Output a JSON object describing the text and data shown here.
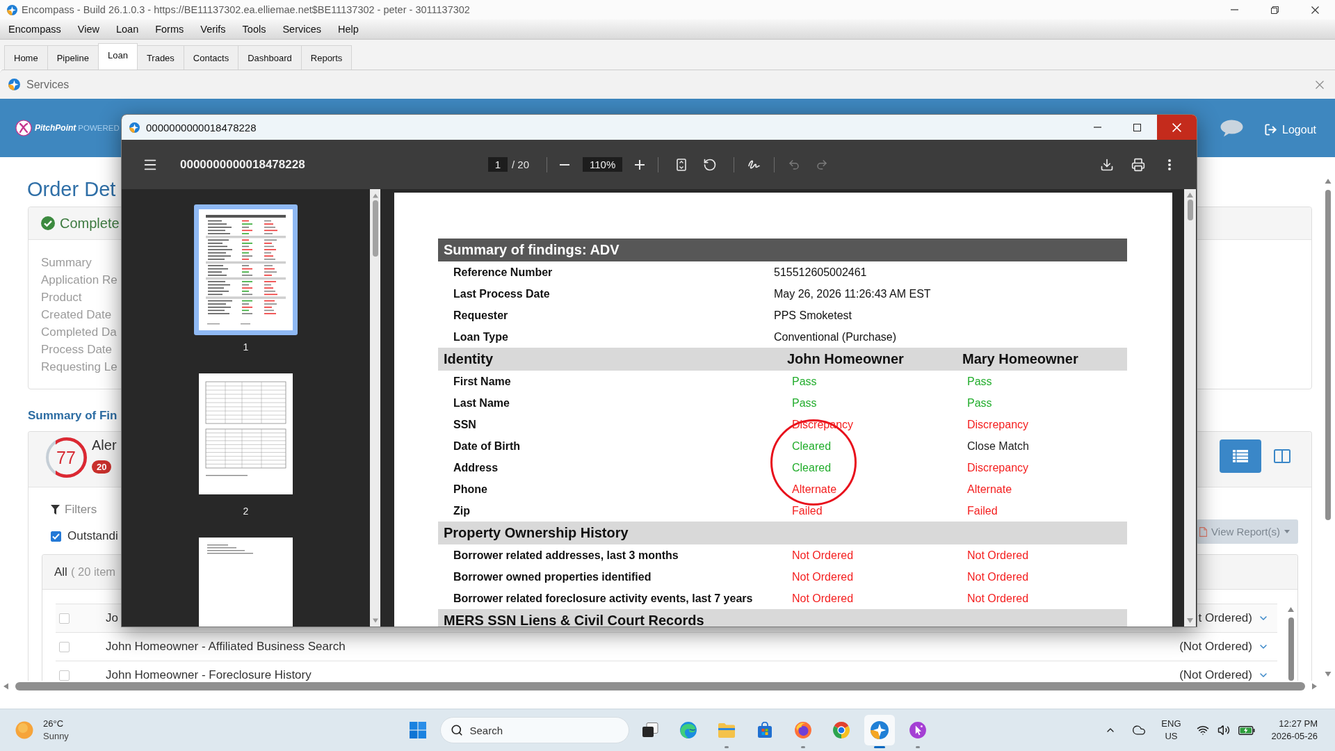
{
  "window": {
    "title": "Encompass - Build 26.1.0.3 - https://BE11137302.ea.elliemae.net$BE11137302 - peter - 3011137302"
  },
  "menu": [
    "Encompass",
    "View",
    "Loan",
    "Forms",
    "Verifs",
    "Tools",
    "Services",
    "Help"
  ],
  "tabs": [
    {
      "label": "Home",
      "selected": false
    },
    {
      "label": "Pipeline",
      "selected": false
    },
    {
      "label": "Loan",
      "selected": true
    },
    {
      "label": "Trades",
      "selected": false
    },
    {
      "label": "Contacts",
      "selected": false
    },
    {
      "label": "Dashboard",
      "selected": false
    },
    {
      "label": "Reports",
      "selected": false
    }
  ],
  "services_panel": {
    "title": "Services"
  },
  "header": {
    "brand": "PitchPoint",
    "tagline": "POWERED",
    "logout": "Logout"
  },
  "order_details": {
    "title": "Order Det",
    "status": "Complete",
    "fields": [
      "Summary",
      "Application Re",
      "Product",
      "Created Date",
      "Completed Da",
      "Process Date",
      "Requesting Le"
    ]
  },
  "findings": {
    "heading": "Summary of Fin",
    "score": "77",
    "level": 0.77,
    "alerts_label": "Aler",
    "alerts_count": "20",
    "views": [
      {
        "kind": "list",
        "selected": true
      },
      {
        "kind": "split",
        "selected": false
      }
    ],
    "filters_label": "Filters",
    "outstanding": {
      "label": "Outstandi",
      "checked": true
    },
    "view_reports": {
      "label": "View Report(s)",
      "disabled": true
    },
    "list": {
      "title": "All",
      "count": "( 20 item",
      "rows": [
        {
          "name": "Jo",
          "status": "t Ordered)",
          "checked": false
        },
        {
          "name": "John Homeowner - Affiliated Business Search",
          "status": "(Not Ordered)",
          "checked": false
        },
        {
          "name": "John Homeowner - Foreclosure History",
          "status": "(Not Ordered)",
          "checked": false
        }
      ]
    }
  },
  "viewer": {
    "window_title": "0000000000018478228",
    "doc_title": "0000000000018478228",
    "page": "1",
    "page_total": "/ 20",
    "zoom": "110%",
    "undo_disabled": true,
    "redo_disabled": true,
    "thumbnails": [
      {
        "label": "1",
        "selected": true
      },
      {
        "label": "2",
        "selected": false
      },
      {
        "selected": false
      }
    ],
    "report": {
      "title": "Summary of findings: ADV",
      "info": [
        {
          "label": "Reference Number",
          "value": "515512605002461"
        },
        {
          "label": "Last Process Date",
          "value": "May 26, 2026 11:26:43 AM EST"
        },
        {
          "label": "Requester",
          "value": "PPS Smoketest"
        },
        {
          "label": "Loan Type",
          "value": "Conventional (Purchase)"
        }
      ],
      "sections": [
        {
          "title": "Identity",
          "columns": [
            "John Homeowner",
            "Mary Homeowner"
          ],
          "rows": [
            {
              "label": "First Name",
              "results": [
                {
                  "text": "Pass",
                  "color": "#22ad2c"
                },
                {
                  "text": "Pass",
                  "color": "#22ad2c"
                }
              ]
            },
            {
              "label": "Last Name",
              "results": [
                {
                  "text": "Pass",
                  "color": "#22ad2c"
                },
                {
                  "text": "Pass",
                  "color": "#22ad2c"
                }
              ]
            },
            {
              "label": "SSN",
              "results": [
                {
                  "text": "Discrepancy",
                  "color": "#f41e1e"
                },
                {
                  "text": "Discrepancy",
                  "color": "#f41e1e"
                }
              ]
            },
            {
              "label": "Date of Birth",
              "results": [
                {
                  "text": "Cleared",
                  "color": "#22ad2c"
                },
                {
                  "text": "Close Match",
                  "color": "#222222"
                }
              ]
            },
            {
              "label": "Address",
              "results": [
                {
                  "text": "Cleared",
                  "color": "#22ad2c"
                },
                {
                  "text": "Discrepancy",
                  "color": "#f41e1e"
                }
              ]
            },
            {
              "label": "Phone",
              "results": [
                {
                  "text": "Alternate",
                  "color": "#f41e1e"
                },
                {
                  "text": "Alternate",
                  "color": "#f41e1e"
                }
              ]
            },
            {
              "label": "Zip",
              "results": [
                {
                  "text": "Failed",
                  "color": "#f41e1e"
                },
                {
                  "text": "Failed",
                  "color": "#f41e1e"
                }
              ]
            }
          ]
        },
        {
          "title": "Property Ownership History",
          "rows": [
            {
              "label": "Borrower related addresses, last 3 months",
              "results": [
                {
                  "text": "Not Ordered",
                  "color": "#f41e1e"
                },
                {
                  "text": "Not Ordered",
                  "color": "#f41e1e"
                }
              ]
            },
            {
              "label": "Borrower owned properties identified",
              "results": [
                {
                  "text": "Not Ordered",
                  "color": "#f41e1e"
                },
                {
                  "text": "Not Ordered",
                  "color": "#f41e1e"
                }
              ]
            },
            {
              "label": "Borrower related foreclosure activity events, last 7 years",
              "results": [
                {
                  "text": "Not Ordered",
                  "color": "#f41e1e"
                },
                {
                  "text": "Not Ordered",
                  "color": "#f41e1e"
                }
              ]
            }
          ]
        },
        {
          "title": "MERS SSN Liens & Civil Court Records"
        }
      ]
    }
  },
  "taskbar": {
    "weather": {
      "temperature": "26°C",
      "condition": "Sunny"
    },
    "search": {
      "placeholder": "Search"
    },
    "apps": [
      {
        "kind": "squares",
        "running": false,
        "active": false
      },
      {
        "kind": "wave",
        "running": false,
        "active": false
      },
      {
        "kind": "folder",
        "running": true,
        "active": false
      },
      {
        "kind": "bag",
        "running": false,
        "active": false
      },
      {
        "kind": "flame",
        "running": true,
        "active": false
      },
      {
        "kind": "ring",
        "running": false,
        "active": false
      },
      {
        "kind": "star",
        "running": true,
        "active": true
      },
      {
        "kind": "cursor",
        "running": true,
        "active": false
      }
    ],
    "language": {
      "code": "ENG",
      "region": "US"
    },
    "clock": {
      "time": "12:27 PM",
      "date": "2026-05-26"
    }
  }
}
